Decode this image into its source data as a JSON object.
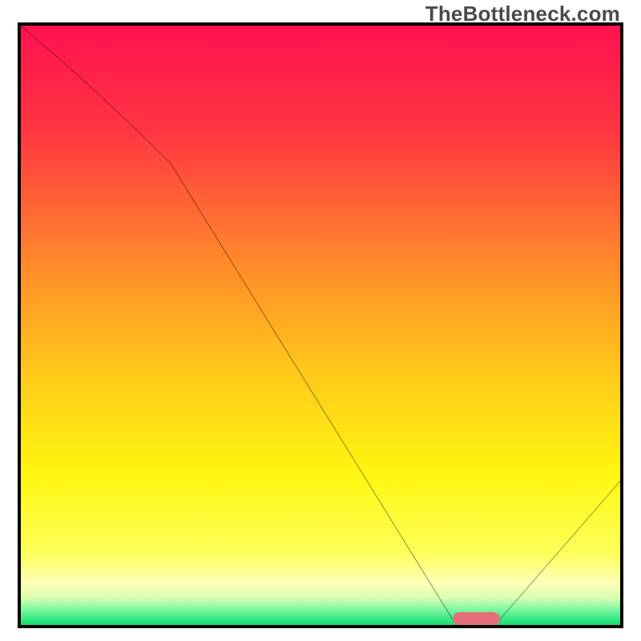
{
  "watermark": "TheBottleneck.com",
  "chart_data": {
    "type": "line",
    "title": "",
    "xlabel": "",
    "ylabel": "",
    "xlim": [
      0,
      100
    ],
    "ylim": [
      0,
      100
    ],
    "grid": false,
    "legend": false,
    "series": [
      {
        "name": "bottleneck-curve",
        "x": [
          0,
          25,
          72,
          80,
          100
        ],
        "y": [
          100,
          77,
          1,
          1,
          24
        ],
        "style": "black-line"
      }
    ],
    "marker": {
      "x0": 72,
      "x1": 80,
      "y": 1,
      "color": "#e66f78"
    },
    "background_gradient": [
      {
        "stop": 0.0,
        "color": "#ff114f"
      },
      {
        "stop": 0.18,
        "color": "#ff3741"
      },
      {
        "stop": 0.4,
        "color": "#ff8b2a"
      },
      {
        "stop": 0.58,
        "color": "#ffc91a"
      },
      {
        "stop": 0.75,
        "color": "#fff710"
      },
      {
        "stop": 0.88,
        "color": "#fdff5a"
      },
      {
        "stop": 0.93,
        "color": "#feffb8"
      },
      {
        "stop": 0.955,
        "color": "#d9ffb0"
      },
      {
        "stop": 0.975,
        "color": "#7af7a0"
      },
      {
        "stop": 1.0,
        "color": "#10dd70"
      }
    ]
  }
}
